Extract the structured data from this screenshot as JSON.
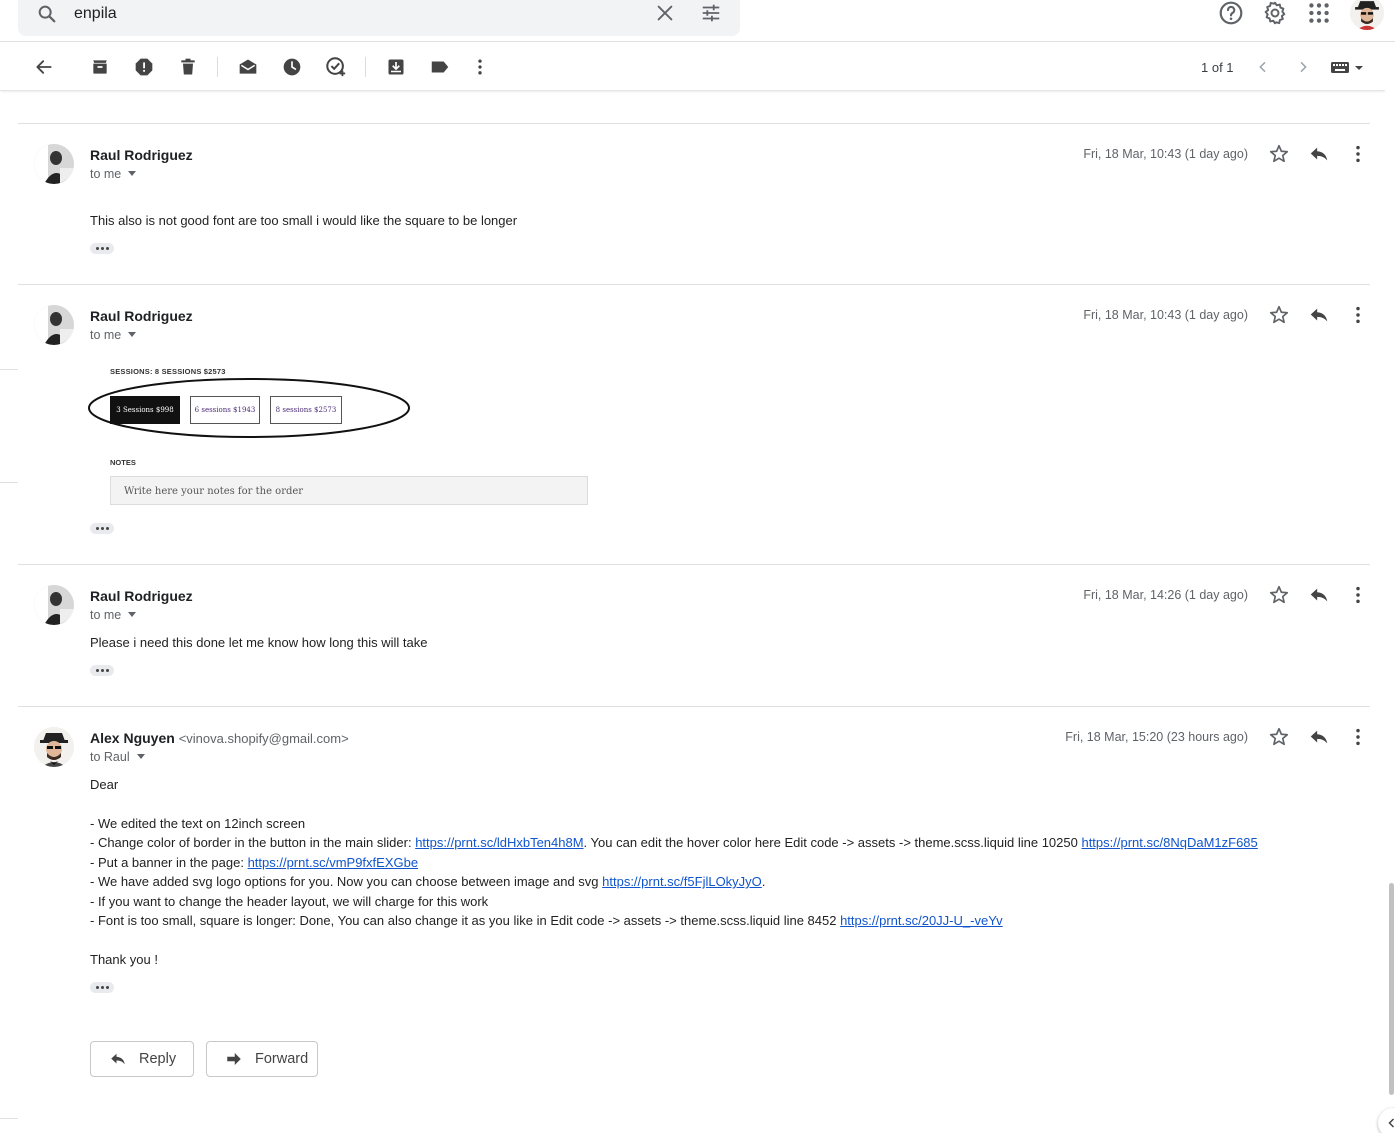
{
  "search": {
    "value": "enpila"
  },
  "toolbar": {
    "pager": "1 of 1"
  },
  "messages": [
    {
      "sender": "Raul Rodriguez",
      "recipient": "to me",
      "date": "Fri, 18 Mar, 10:43 (1 day ago)",
      "body": "This also is not good font are too small i would like the square to be longer"
    },
    {
      "sender": "Raul Rodriguez",
      "recipient": "to me",
      "date": "Fri, 18 Mar, 10:43 (1 day ago)",
      "embedded_image": {
        "title": "SESSIONS: 8 SESSIONS $2573",
        "options": [
          "3 Sessions $998",
          "6 sessions $1943",
          "8 sessions $2573"
        ],
        "notes_label": "NOTES",
        "notes_placeholder": "Write here your notes for the order"
      }
    },
    {
      "sender": "Raul Rodriguez",
      "recipient": "to me",
      "date": "Fri, 18 Mar, 14:26 (1 day ago)",
      "body": "Please i need this done let me know how long this will take"
    },
    {
      "sender": "Alex Nguyen",
      "sender_email": "<vinova.shopify@gmail.com>",
      "recipient": "to Raul",
      "date": "Fri, 18 Mar, 15:20 (23 hours ago)",
      "greeting": "Dear",
      "lines": [
        {
          "text": "- We edited the text on 12inch screen"
        },
        {
          "text": "- Change color of border in the button in the main slider: ",
          "link1": "https://prnt.sc/ldHxbTen4h8M",
          "mid": ". You can edit the hover color here Edit code -> assets -> theme.scss.liquid line 10250 ",
          "link2": "https://prnt.sc/8NqDaM1zF685"
        },
        {
          "text": "- Put a banner in the page: ",
          "link1": "https://prnt.sc/vmP9fxfEXGbe"
        },
        {
          "text": "- We have added svg logo options for you. Now you can choose between image and svg ",
          "link1": "https://prnt.sc/f5FjlLOkyJyO",
          "after": "."
        },
        {
          "text": "- If you want to change the header layout, we will charge for this work"
        },
        {
          "text": "- Font is too small, square is longer: Done, You can also change it as you like in Edit code -> assets -> theme.scss.liquid line 8452 ",
          "link1": "https://prnt.sc/20JJ-U_-veYv"
        }
      ],
      "closing": "Thank you !"
    }
  ],
  "actions": {
    "reply": "Reply",
    "forward": "Forward"
  },
  "colors": {
    "link": "#1155cc",
    "secondary_text": "#5f6368",
    "search_bg": "#f1f3f4"
  }
}
